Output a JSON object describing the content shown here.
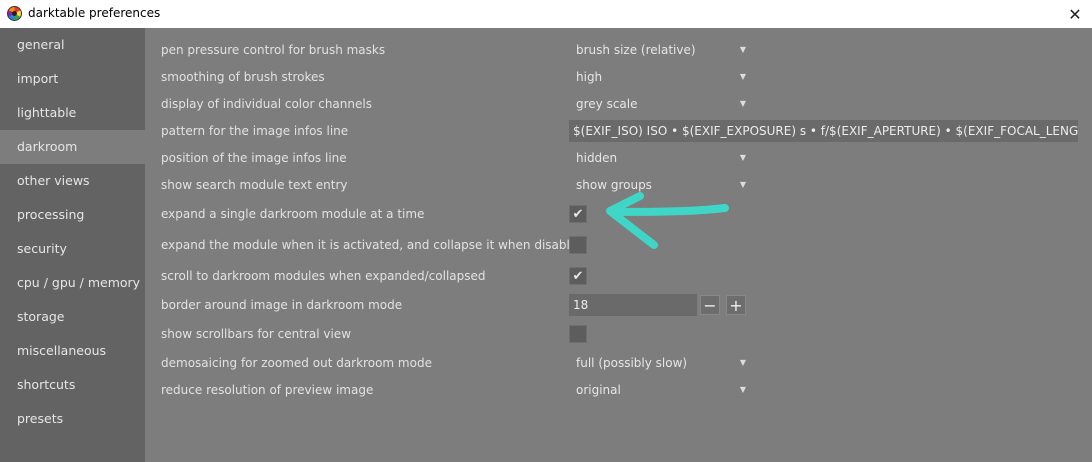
{
  "window": {
    "title": "darktable preferences",
    "close_glyph": "✕",
    "icon": "darktable-icon"
  },
  "sidebar": {
    "items": [
      {
        "label": "general"
      },
      {
        "label": "import"
      },
      {
        "label": "lighttable"
      },
      {
        "label": "darkroom",
        "active": true
      },
      {
        "label": "other views"
      },
      {
        "label": "processing"
      },
      {
        "label": "security"
      },
      {
        "label": "cpu / gpu / memory"
      },
      {
        "label": "storage"
      },
      {
        "label": "miscellaneous"
      },
      {
        "label": "shortcuts"
      },
      {
        "label": "presets"
      }
    ]
  },
  "settings": [
    {
      "label": "pen pressure control for brush masks",
      "type": "dropdown",
      "value": "brush size (relative)"
    },
    {
      "label": "smoothing of brush strokes",
      "type": "dropdown",
      "value": "high"
    },
    {
      "label": "display of individual color channels",
      "type": "dropdown",
      "value": "grey scale"
    },
    {
      "label": "pattern for the image infos line",
      "type": "text",
      "value": "$(EXIF_ISO) ISO • $(EXIF_EXPOSURE) s • f/$(EXIF_APERTURE) • $(EXIF_FOCAL_LENGTH) mm"
    },
    {
      "label": "position of the image infos line",
      "type": "dropdown",
      "value": "hidden"
    },
    {
      "label": "show search module text entry",
      "type": "dropdown",
      "value": "show groups"
    },
    {
      "label": "expand a single darkroom module at a time",
      "type": "checkbox",
      "checked": true
    },
    {
      "label": "expand the module when it is activated, and collapse it when disabled",
      "type": "checkbox",
      "checked": false
    },
    {
      "label": "scroll to darkroom modules when expanded/collapsed",
      "type": "checkbox",
      "checked": true
    },
    {
      "label": "border around image in darkroom mode",
      "type": "spin",
      "value": "18",
      "minus": "−",
      "plus": "+"
    },
    {
      "label": "show scrollbars for central view",
      "type": "checkbox",
      "checked": false
    },
    {
      "label": "demosaicing for zoomed out darkroom mode",
      "type": "dropdown",
      "value": "full (possibly slow)"
    },
    {
      "label": "reduce resolution of preview image",
      "type": "dropdown",
      "value": "original"
    }
  ],
  "glyphs": {
    "caret": "▼",
    "check": "✔"
  },
  "colors": {
    "annotation_arrow": "#3fd6c8",
    "sidebar_bg": "#636363",
    "main_bg": "#7d7d7d"
  }
}
